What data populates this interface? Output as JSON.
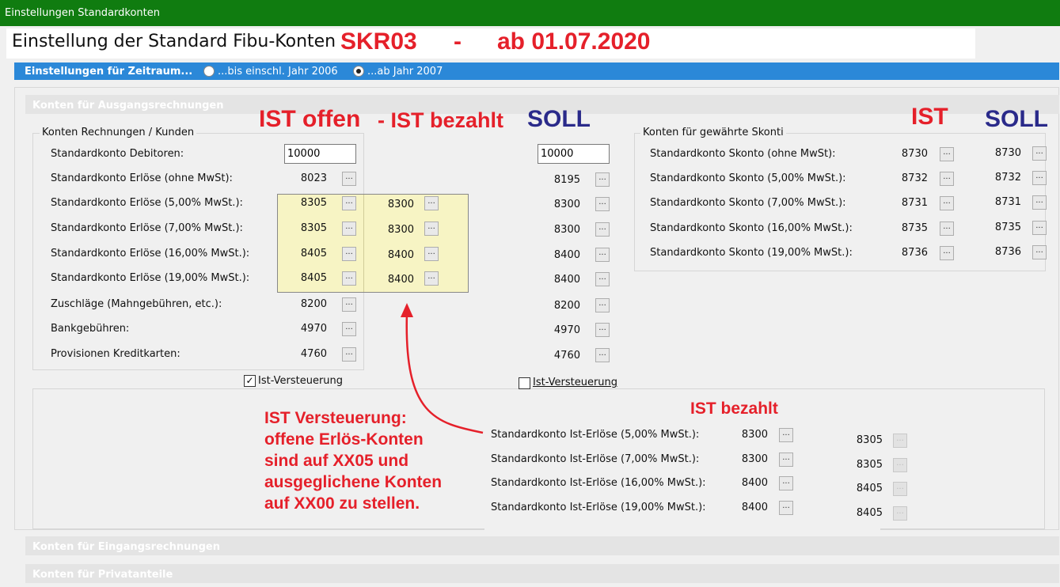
{
  "window": {
    "title": "Einstellungen Standardkonten"
  },
  "page": {
    "heading": "Einstellung der Standard Fibu-Konten",
    "annot_title": {
      "skr": "SKR03",
      "dash": "-",
      "date": "ab 01.07.2020"
    }
  },
  "zeitraum_bar": {
    "label": "Einstellungen für Zeitraum...",
    "option1": "...bis einschl. Jahr 2006",
    "option2": "...ab Jahr 2007",
    "selected": "option2"
  },
  "section_ausgang": {
    "title": "Konten für Ausgangsrechnungen",
    "group_left_title": "Konten Rechnungen / Kunden",
    "group_right_title": "Konten für gewährte Skonti",
    "rows": [
      {
        "label": "Standardkonto Debitoren:",
        "ist_offen": "10000",
        "ist_bezahlt": "",
        "soll": "10000",
        "input": true
      },
      {
        "label": "Standardkonto Erlöse (ohne MwSt):",
        "ist_offen": "8023",
        "ist_bezahlt": "",
        "soll": "8195"
      },
      {
        "label": "Standardkonto Erlöse (5,00% MwSt.):",
        "ist_offen": "8305",
        "ist_bezahlt": "8300",
        "soll": "8300"
      },
      {
        "label": "Standardkonto Erlöse (7,00% MwSt.):",
        "ist_offen": "8305",
        "ist_bezahlt": "8300",
        "soll": "8300"
      },
      {
        "label": "Standardkonto Erlöse (16,00% MwSt.):",
        "ist_offen": "8405",
        "ist_bezahlt": "8400",
        "soll": "8400"
      },
      {
        "label": "Standardkonto Erlöse (19,00% MwSt.):",
        "ist_offen": "8405",
        "ist_bezahlt": "8400",
        "soll": "8400"
      },
      {
        "label": "Zuschläge (Mahngebühren, etc.):",
        "ist_offen": "8200",
        "ist_bezahlt": "",
        "soll": "8200"
      },
      {
        "label": "Bankgebühren:",
        "ist_offen": "4970",
        "ist_bezahlt": "",
        "soll": "4970"
      },
      {
        "label": "Provisionen Kreditkarten:",
        "ist_offen": "4760",
        "ist_bezahlt": "",
        "soll": "4760"
      }
    ],
    "skonti_rows": [
      {
        "label": "Standardkonto Skonto (ohne MwSt):",
        "ist": "8730",
        "soll": "8730"
      },
      {
        "label": "Standardkonto Skonto (5,00% MwSt.):",
        "ist": "8732",
        "soll": "8732"
      },
      {
        "label": "Standardkonto Skonto (7,00% MwSt.):",
        "ist": "8731",
        "soll": "8731"
      },
      {
        "label": "Standardkonto Skonto (16,00% MwSt.):",
        "ist": "8735",
        "soll": "8735"
      },
      {
        "label": "Standardkonto Skonto (19,00% MwSt.):",
        "ist": "8736",
        "soll": "8736"
      }
    ],
    "checkbox_ist_left": {
      "label": "Ist-Versteuerung",
      "checked": true
    },
    "checkbox_ist_right": {
      "label": "Ist-Versteuerung",
      "checked": false
    },
    "ist_erloese_rows": [
      {
        "label": "Standardkonto Ist-Erlöse (5,00% MwSt.):",
        "value": "8300",
        "disabled_value": "8305"
      },
      {
        "label": "Standardkonto Ist-Erlöse (7,00% MwSt.):",
        "value": "8300",
        "disabled_value": "8305"
      },
      {
        "label": "Standardkonto Ist-Erlöse (16,00% MwSt.):",
        "value": "8400",
        "disabled_value": "8405"
      },
      {
        "label": "Standardkonto Ist-Erlöse (19,00% MwSt.):",
        "value": "8400",
        "disabled_value": "8405"
      }
    ],
    "ellipsis": "..."
  },
  "annotations": {
    "ist_offen": "IST offen",
    "ist_bezahlt_head": "- IST bezahlt",
    "soll": "SOLL",
    "ist": "IST",
    "soll_right": "SOLL",
    "ist_bezahlt_lower": "IST bezahlt",
    "note_lines": [
      "IST Versteuerung:",
      "offene Erlös-Konten",
      "sind auf XX05 und",
      "ausgeglichene Konten",
      "auf XX00 zu stellen."
    ],
    "colors": {
      "red": "#e5202a",
      "blue": "#2a2a8a",
      "highlight": "#f7f4c4"
    }
  },
  "section_eingang": {
    "title": "Konten für Eingangsrechnungen"
  },
  "section_privat": {
    "title": "Konten für Privatanteile"
  }
}
